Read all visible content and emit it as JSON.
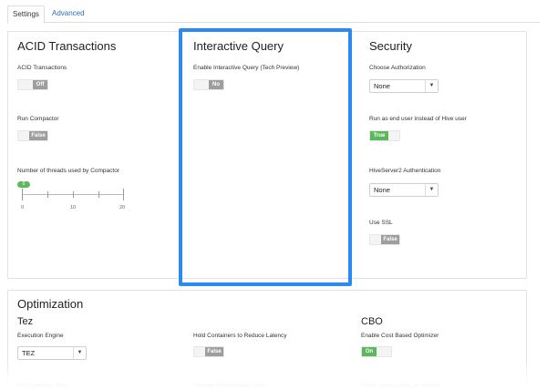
{
  "tabs": [
    {
      "label": "Settings",
      "active": true
    },
    {
      "label": "Advanced",
      "active": false
    }
  ],
  "acid": {
    "title": "ACID Transactions",
    "acid_label": "ACID Transactions",
    "acid_value": "Off",
    "compactor_label": "Run Compactor",
    "compactor_value": "False",
    "threads_label": "Number of threads used by Compactor",
    "threads_value": "0",
    "slider_ticks": [
      "0",
      "10",
      "20"
    ]
  },
  "interactive": {
    "title": "Interactive Query",
    "enable_label": "Enable Interactive Query (Tech Preview)",
    "enable_value": "No"
  },
  "security": {
    "title": "Security",
    "auth_label": "Choose Authorization",
    "auth_value": "None",
    "run_as_label": "Run as end user instead of Hive user",
    "run_as_value": "True",
    "hs2_label": "HiveServer2 Authentication",
    "hs2_value": "None",
    "ssl_label": "Use SSL",
    "ssl_value": "False"
  },
  "optimization": {
    "title": "Optimization",
    "tez_title": "Tez",
    "engine_label": "Execution Engine",
    "engine_value": "TEZ",
    "container_size_label": "Tez Container Size",
    "hold_label": "Hold Containers to Reduce Latency",
    "hold_value": "False",
    "containers_held_label": "Number of Containers Held",
    "cbo_title": "CBO",
    "cbo_label": "Enable Cost Based Optimizer",
    "cbo_value": "On",
    "fetch_label": "Fetch column stats at compiler"
  },
  "colors": {
    "accent": "#2a8af0",
    "toggle_on": "#5cb85c",
    "toggle_off": "#9e9e9e",
    "link": "#2a6fbd"
  },
  "icons": {
    "dropdown": "chevron-down-icon"
  }
}
